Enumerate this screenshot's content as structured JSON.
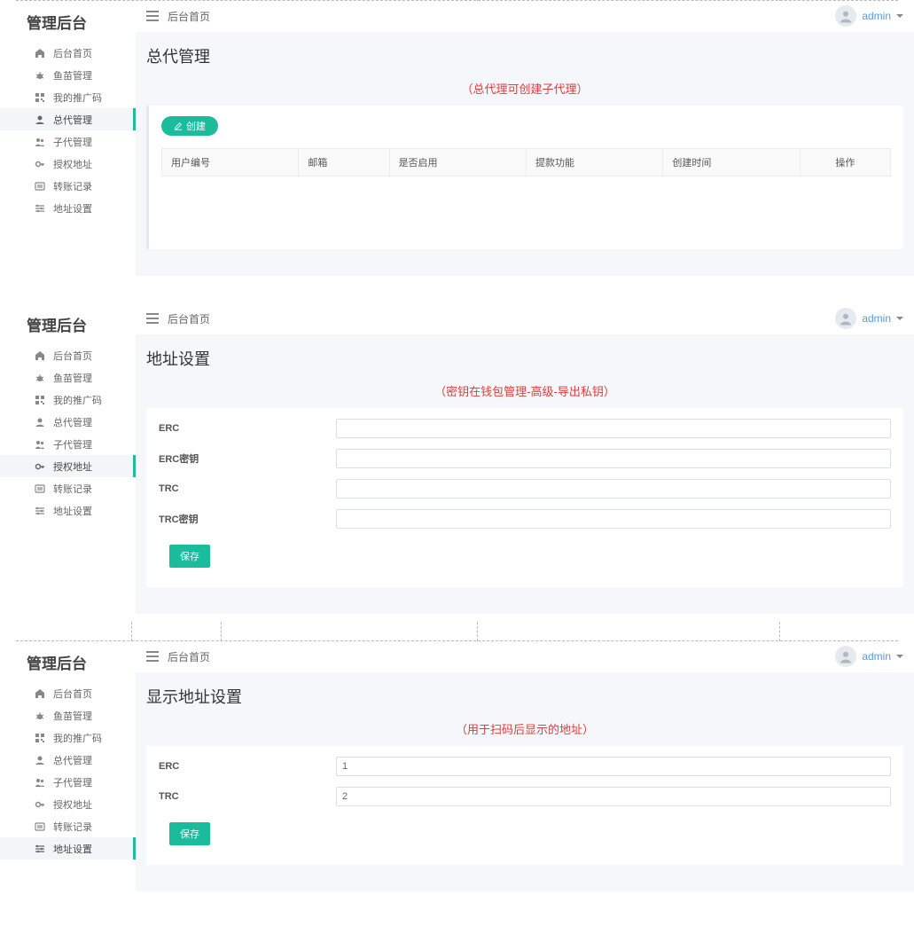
{
  "common": {
    "brand": "管理后台",
    "breadcrumb": "后台首页",
    "user": "admin",
    "sidebar": [
      {
        "icon": "home",
        "label": "后台首页"
      },
      {
        "icon": "bug",
        "label": "鱼苗管理"
      },
      {
        "icon": "qrcode",
        "label": "我的推广码"
      },
      {
        "icon": "person",
        "label": "总代管理"
      },
      {
        "icon": "people",
        "label": "子代管理"
      },
      {
        "icon": "key",
        "label": "授权地址"
      },
      {
        "icon": "list",
        "label": "转账记录"
      },
      {
        "icon": "settings",
        "label": "地址设置"
      }
    ]
  },
  "panel1": {
    "title": "总代管理",
    "note": "（总代理可创建子代理）",
    "create_label": "创建",
    "columns": [
      "用户编号",
      "邮箱",
      "是否启用",
      "提款功能",
      "创建时间",
      "操作"
    ]
  },
  "panel2": {
    "title": "地址设置",
    "note": "（密钥在钱包管理-高级-导出私钥）",
    "save_label": "保存",
    "fields": [
      {
        "label": "ERC",
        "value": ""
      },
      {
        "label": "ERC密钥",
        "value": ""
      },
      {
        "label": "TRC",
        "value": ""
      },
      {
        "label": "TRC密钥",
        "value": ""
      }
    ]
  },
  "panel3": {
    "title": "显示地址设置",
    "note": "（用于扫码后显示的地址）",
    "save_label": "保存",
    "fields": [
      {
        "label": "ERC",
        "value": "1"
      },
      {
        "label": "TRC",
        "value": "2"
      }
    ]
  }
}
